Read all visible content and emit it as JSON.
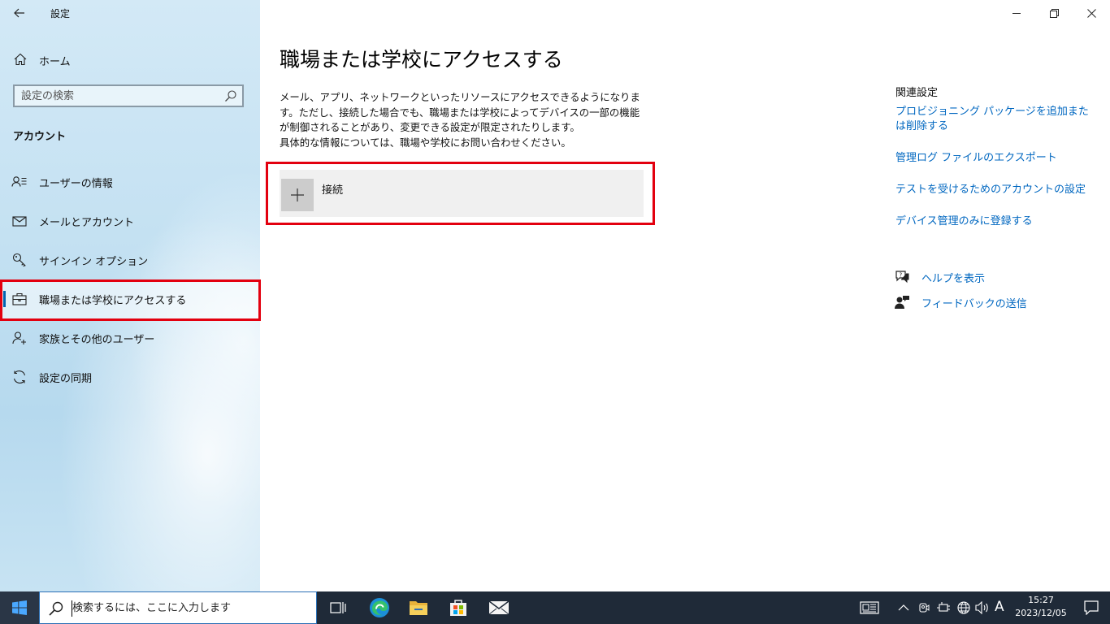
{
  "app": {
    "title": "設定"
  },
  "sidebar": {
    "home_label": "ホーム",
    "search_placeholder": "設定の検索",
    "section_title": "アカウント",
    "items": [
      {
        "label": "ユーザーの情報",
        "icon": "user-info-icon"
      },
      {
        "label": "メールとアカウント",
        "icon": "mail-icon"
      },
      {
        "label": "サインイン オプション",
        "icon": "key-icon"
      },
      {
        "label": "職場または学校にアクセスする",
        "icon": "briefcase-icon",
        "selected": true
      },
      {
        "label": "家族とその他のユーザー",
        "icon": "add-user-icon"
      },
      {
        "label": "設定の同期",
        "icon": "sync-icon"
      }
    ]
  },
  "main": {
    "title": "職場または学校にアクセスする",
    "description": [
      "メール、アプリ、ネットワークといったリソースにアクセスできるようになります。ただし、接続した場合でも、職場または学校によってデバイスの一部の機能が制御されることがあり、変更できる設定が限定されたりします。",
      "具体的な情報については、職場や学校にお問い合わせください。"
    ],
    "connect_label": "接続"
  },
  "related": {
    "title": "関連設定",
    "links": [
      "プロビジョニング パッケージを追加または削除する",
      "管理ログ ファイルのエクスポート",
      "テストを受けるためのアカウントの設定",
      "デバイス管理のみに登録する"
    ],
    "help_label": "ヘルプを表示",
    "feedback_label": "フィードバックの送信"
  },
  "taskbar": {
    "search_placeholder": "検索するには、ここに入力します",
    "ime": "A",
    "time": "15:27",
    "date": "2023/12/05"
  },
  "colors": {
    "accent": "#0063b1",
    "link": "#0067c0",
    "highlight": "#e3000f",
    "taskbar": "#1f2a38"
  }
}
